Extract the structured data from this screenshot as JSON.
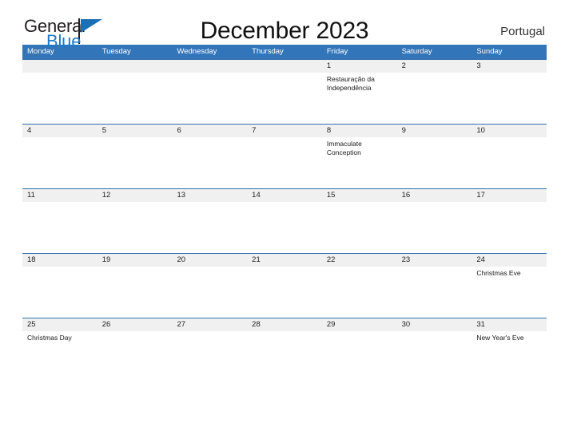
{
  "brand": {
    "name_part1": "General",
    "name_part2": "Blue",
    "flag_icon": "flag-icon"
  },
  "header": {
    "title": "December 2023",
    "country": "Portugal"
  },
  "calendar": {
    "weekdays": [
      "Monday",
      "Tuesday",
      "Wednesday",
      "Thursday",
      "Friday",
      "Saturday",
      "Sunday"
    ],
    "weeks": [
      [
        {
          "date": "",
          "event": ""
        },
        {
          "date": "",
          "event": ""
        },
        {
          "date": "",
          "event": ""
        },
        {
          "date": "",
          "event": ""
        },
        {
          "date": "1",
          "event": "Restauração da Independência"
        },
        {
          "date": "2",
          "event": ""
        },
        {
          "date": "3",
          "event": ""
        }
      ],
      [
        {
          "date": "4",
          "event": ""
        },
        {
          "date": "5",
          "event": ""
        },
        {
          "date": "6",
          "event": ""
        },
        {
          "date": "7",
          "event": ""
        },
        {
          "date": "8",
          "event": "Immaculate Conception"
        },
        {
          "date": "9",
          "event": ""
        },
        {
          "date": "10",
          "event": ""
        }
      ],
      [
        {
          "date": "11",
          "event": ""
        },
        {
          "date": "12",
          "event": ""
        },
        {
          "date": "13",
          "event": ""
        },
        {
          "date": "14",
          "event": ""
        },
        {
          "date": "15",
          "event": ""
        },
        {
          "date": "16",
          "event": ""
        },
        {
          "date": "17",
          "event": ""
        }
      ],
      [
        {
          "date": "18",
          "event": ""
        },
        {
          "date": "19",
          "event": ""
        },
        {
          "date": "20",
          "event": ""
        },
        {
          "date": "21",
          "event": ""
        },
        {
          "date": "22",
          "event": ""
        },
        {
          "date": "23",
          "event": ""
        },
        {
          "date": "24",
          "event": "Christmas Eve"
        }
      ],
      [
        {
          "date": "25",
          "event": "Christmas Day"
        },
        {
          "date": "26",
          "event": ""
        },
        {
          "date": "27",
          "event": ""
        },
        {
          "date": "28",
          "event": ""
        },
        {
          "date": "29",
          "event": ""
        },
        {
          "date": "30",
          "event": ""
        },
        {
          "date": "31",
          "event": "New Year's Eve"
        }
      ]
    ]
  },
  "colors": {
    "header_blue": "#3275b8",
    "row_border_blue": "#2f6fad",
    "day_band_gray": "#f0f0f0",
    "brand_blue": "#1e7bc8"
  }
}
